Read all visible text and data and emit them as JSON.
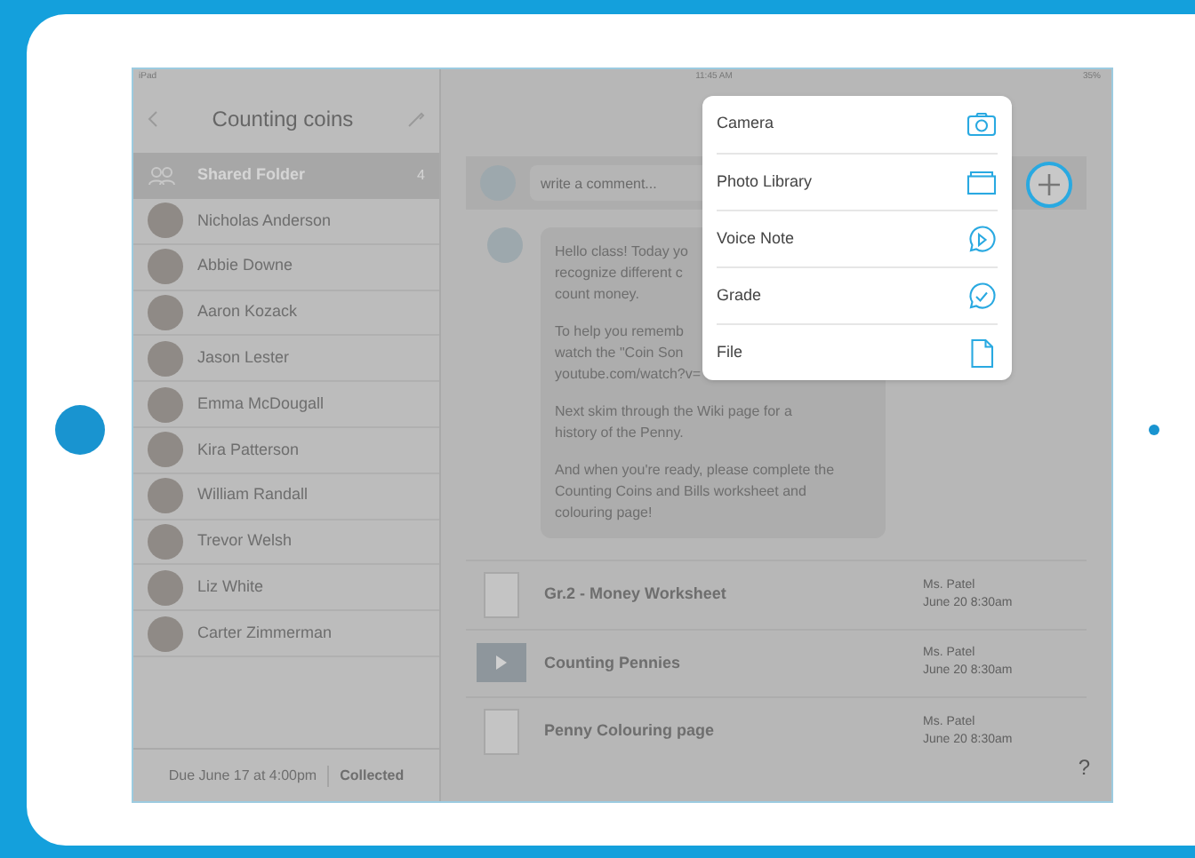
{
  "status_bar": {
    "device": "iPad",
    "time": "11:45 AM",
    "battery": "35%"
  },
  "sidebar": {
    "title": "Counting coins",
    "shared_folder": {
      "label": "Shared Folder",
      "count": "4",
      "selected": true
    },
    "students": [
      {
        "name": "Nicholas Anderson"
      },
      {
        "name": "Abbie Downe"
      },
      {
        "name": "Aaron Kozack"
      },
      {
        "name": "Jason Lester"
      },
      {
        "name": "Emma McDougall"
      },
      {
        "name": "Kira Patterson"
      },
      {
        "name": "William Randall"
      },
      {
        "name": "Trevor Welsh"
      },
      {
        "name": "Liz White"
      },
      {
        "name": "Carter Zimmerman"
      }
    ],
    "footer": {
      "due": "Due June 17 at 4:00pm",
      "status": "Collected"
    }
  },
  "comment": {
    "placeholder": "write a comment..."
  },
  "message": {
    "paragraphs": [
      [
        "Hello class! Today yo",
        "recognize different c",
        "count money."
      ],
      [
        "To help you rememb",
        "watch the \"Coin Son",
        "youtube.com/watch?v="
      ],
      [
        "Next skim through the Wiki page for a",
        "history of the Penny."
      ],
      [
        "And when you're ready, please complete the",
        "Counting Coins and Bills worksheet and",
        "colouring page!"
      ]
    ]
  },
  "attach_menu": [
    {
      "label": "Camera",
      "kind": "camera"
    },
    {
      "label": "Photo Library",
      "kind": "library"
    },
    {
      "label": "Voice Note",
      "kind": "voice"
    },
    {
      "label": "Grade",
      "kind": "grade"
    },
    {
      "label": "File",
      "kind": "file"
    }
  ],
  "files": [
    {
      "title": "Gr.2 - Money Worksheet",
      "kind": "document",
      "author": "Ms. Patel",
      "date": "June 20 8:30am"
    },
    {
      "title": "Counting Pennies",
      "kind": "video",
      "author": "Ms. Patel",
      "date": "June 20 8:30am"
    },
    {
      "title": "Penny Colouring page",
      "kind": "document",
      "author": "Ms. Patel",
      "date": "June 20 8:30am"
    }
  ],
  "help": "?"
}
